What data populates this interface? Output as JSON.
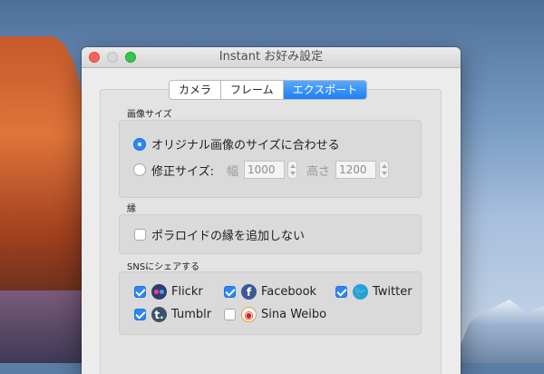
{
  "window": {
    "title": "Instant お好み設定"
  },
  "tabs": [
    {
      "label": "カメラ",
      "active": false
    },
    {
      "label": "フレーム",
      "active": false
    },
    {
      "label": "エクスポート",
      "active": true
    }
  ],
  "image_size": {
    "section_label": "画像サイズ",
    "option_original": {
      "label": "オリジナル画像のサイズに合わせる",
      "selected": true
    },
    "option_custom": {
      "label": "修正サイズ:",
      "selected": false
    },
    "width_label": "幅",
    "width_value": "1000",
    "height_label": "高さ",
    "height_value": "1200"
  },
  "border": {
    "section_label": "縁",
    "no_border": {
      "label": "ポラロイドの縁を追加しない",
      "checked": false
    }
  },
  "sns": {
    "section_label": "SNSにシェアする",
    "services": [
      {
        "label": "Flickr",
        "checked": true,
        "icon": "flickr-icon"
      },
      {
        "label": "Facebook",
        "checked": true,
        "icon": "facebook-icon",
        "glyph": "f"
      },
      {
        "label": "Twitter",
        "checked": true,
        "icon": "twitter-icon",
        "glyph": "🐦"
      },
      {
        "label": "Tumblr",
        "checked": true,
        "icon": "tumblr-icon",
        "glyph": "t."
      },
      {
        "label": "Sina Weibo",
        "checked": false,
        "icon": "weibo-icon",
        "glyph": "◉"
      }
    ]
  },
  "colors": {
    "accent": "#2b86f8",
    "close": "#fc605b",
    "maximize": "#34c84a"
  }
}
